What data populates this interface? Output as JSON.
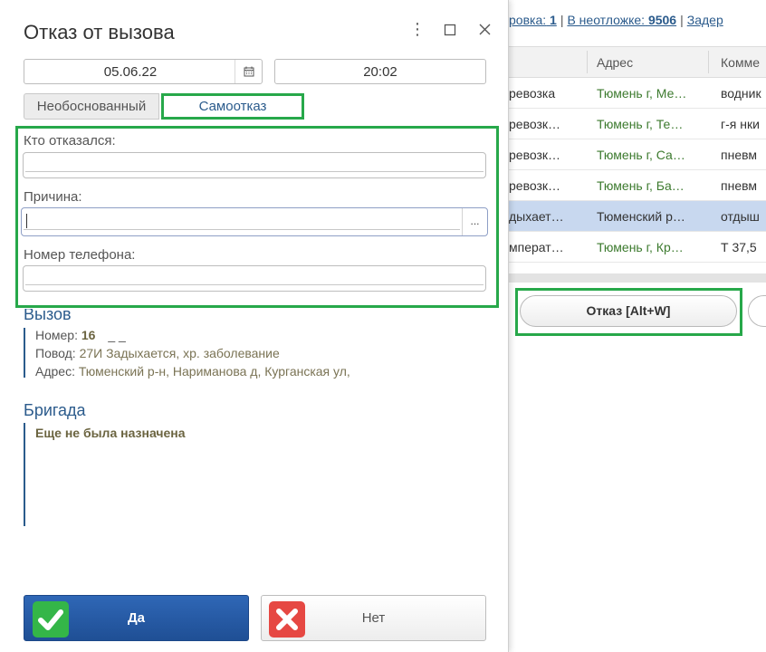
{
  "background": {
    "links": {
      "first_label": "ровка:",
      "first_count": "1",
      "second_label": "В неотложке:",
      "second_count": "9506",
      "third_label": "Задер"
    },
    "grid": {
      "columns": [
        "Адрес",
        "Комме"
      ],
      "rows": [
        {
          "c1": "ревозка",
          "c2": "Тюмень г, Ме…",
          "c3": "водник"
        },
        {
          "c1": "ревозк…",
          "c2": "Тюмень г, Те…",
          "c3": "г-я нки"
        },
        {
          "c1": "ревозк…",
          "c2": "Тюмень г, Са…",
          "c3": "пневм"
        },
        {
          "c1": "ревозк…",
          "c2": "Тюмень г, Ба…",
          "c3": "пневм"
        },
        {
          "c1": "дыхает…",
          "c2": "Тюменский р…",
          "c3": "отдыш"
        },
        {
          "c1": "мперат…",
          "c2": "Тюмень г, Кр…",
          "c3": "Т 37,5"
        }
      ],
      "selected_row": 4
    },
    "refuse_button": "Отказ [Alt+W]"
  },
  "dialog": {
    "title": "Отказ от вызова",
    "menu_icon": "more-vertical-icon",
    "maximize_icon": "maximize-icon",
    "close_icon": "close-icon",
    "date": "05.06.22",
    "time": "20:02",
    "tabs": [
      "Необоснованный",
      "Самоотказ"
    ],
    "active_tab": 1,
    "fields": {
      "who_label": "Кто отказался:",
      "reason_label": "Причина:",
      "phone_label": "Номер телефона:",
      "who_value": "",
      "reason_value": "",
      "phone_value": ""
    },
    "call": {
      "heading": "Вызов",
      "number_label": "Номер:",
      "number_value": "16",
      "number_suffix": "_ _",
      "reason_label": "Повод:",
      "reason_value": "27И Задыхается, хр. заболевание",
      "address_label": "Адрес:",
      "address_value": "Тюменский р-н, Нариманова д, Курганская ул,"
    },
    "brigade": {
      "heading": "Бригада",
      "status": "Еще не была назначена"
    },
    "yes_button": "Да",
    "no_button": "Нет",
    "highlight_color": "#27a84a",
    "accent_color": "#2b5b8c"
  }
}
